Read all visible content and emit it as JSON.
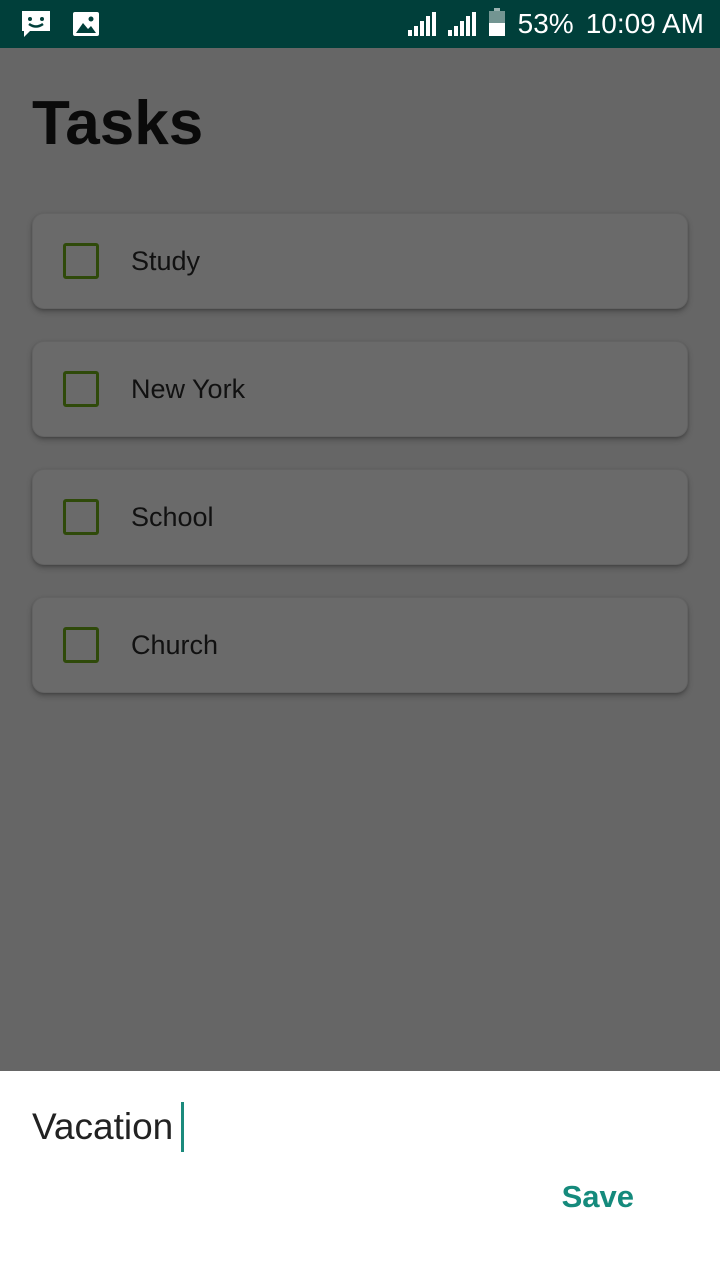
{
  "status_bar": {
    "battery_percent": "53%",
    "time": "10:09 AM",
    "icons": [
      "message-icon",
      "image-icon",
      "signal-icon",
      "signal-icon",
      "battery-icon"
    ],
    "background_color": "#003f3a"
  },
  "page": {
    "title": "Tasks"
  },
  "tasks": [
    {
      "label": "Study",
      "checked": false
    },
    {
      "label": "New York",
      "checked": false
    },
    {
      "label": "School",
      "checked": false
    },
    {
      "label": "Church",
      "checked": false
    }
  ],
  "new_task_sheet": {
    "input_value": "Vacation",
    "save_label": "Save",
    "accent_color": "#158a7c"
  }
}
